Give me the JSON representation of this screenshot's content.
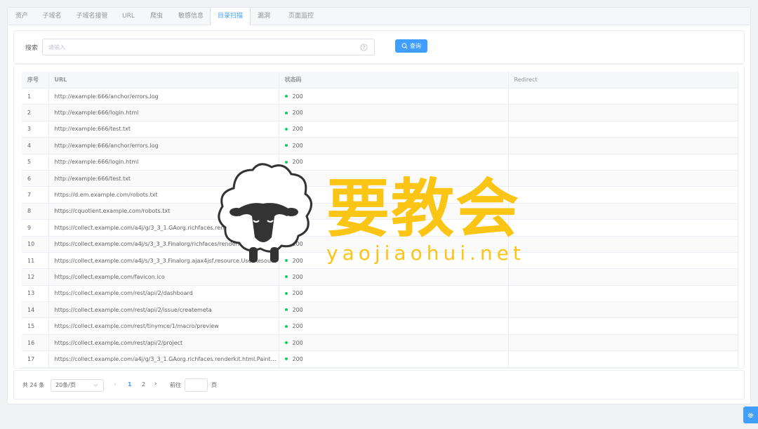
{
  "tabs": [
    {
      "label": "资产"
    },
    {
      "label": "子域名"
    },
    {
      "label": "子域名接管"
    },
    {
      "label": "URL"
    },
    {
      "label": "爬虫"
    },
    {
      "label": "敏感信息"
    },
    {
      "label": "目录扫描"
    },
    {
      "label": "漏洞"
    },
    {
      "label": "页面监控"
    }
  ],
  "active_tab": "目录扫描",
  "search": {
    "label": "搜索",
    "placeholder": "请输入",
    "query_button": "查询"
  },
  "table": {
    "headers": {
      "index": "序号",
      "url": "URL",
      "status": "状态码",
      "redirect": "Redirect"
    },
    "status_dot_color": "#13ce66",
    "rows": [
      {
        "index": "1",
        "url": "http://example:666/anchor/errors.log",
        "status": "200",
        "redirect": ""
      },
      {
        "index": "2",
        "url": "http://example:666/login.html",
        "status": "200",
        "redirect": ""
      },
      {
        "index": "3",
        "url": "http://example:666/test.txt",
        "status": "200",
        "redirect": ""
      },
      {
        "index": "4",
        "url": "http://example:666/anchor/errors.log",
        "status": "200",
        "redirect": ""
      },
      {
        "index": "5",
        "url": "http://example:666/login.html",
        "status": "200",
        "redirect": ""
      },
      {
        "index": "6",
        "url": "http://example:666/test.txt",
        "status": "200",
        "redirect": ""
      },
      {
        "index": "7",
        "url": "https://d.em.example.com/robots.txt",
        "status": "200",
        "redirect": ""
      },
      {
        "index": "8",
        "url": "https://cquotient.example.com/robots.txt",
        "status": "200",
        "redirect": ""
      },
      {
        "index": "9",
        "url": "https://collect.example.com/a4j/g/3_3_1.GAorg.richfaces.renderkit.html.Paint...",
        "status": "200",
        "redirect": ""
      },
      {
        "index": "10",
        "url": "https://collect.example.com/a4j/s/3_3_3.Finalorg/richfaces/renderkit/html/css/basic_...",
        "status": "200",
        "redirect": ""
      },
      {
        "index": "11",
        "url": "https://collect.example.com/a4j/s/3_3_3.Finalorg.ajax4jsf.resource.UserResource/n/...",
        "status": "200",
        "redirect": ""
      },
      {
        "index": "12",
        "url": "https://collect.example.com/favicon.ico",
        "status": "200",
        "redirect": ""
      },
      {
        "index": "13",
        "url": "https://collect.example.com/rest/api/2/dashboard",
        "status": "200",
        "redirect": ""
      },
      {
        "index": "14",
        "url": "https://collect.example.com/rest/api/2/issue/createmeta",
        "status": "200",
        "redirect": ""
      },
      {
        "index": "15",
        "url": "https://collect.example.com/rest/tinymce/1/macro/preview",
        "status": "200",
        "redirect": ""
      },
      {
        "index": "16",
        "url": "https://collect.example.com/rest/api/2/project",
        "status": "200",
        "redirect": ""
      },
      {
        "index": "17",
        "url": "https://collect.example.com/a4j/g/3_3_1.GAorg.richfaces.renderkit.html.Paint2DReso...",
        "status": "200",
        "redirect": ""
      }
    ]
  },
  "pagination": {
    "total": "共 24 条",
    "page_size": "20条/页",
    "pages": [
      "1",
      "2"
    ],
    "current_page": "1",
    "goto_label": "前往",
    "page_suffix": "页",
    "jump_value": ""
  },
  "watermark": {
    "title": "要教会",
    "url": "yaojiaohui.net"
  },
  "colors": {
    "accent": "#409eff",
    "watermark": "#fbc515"
  }
}
